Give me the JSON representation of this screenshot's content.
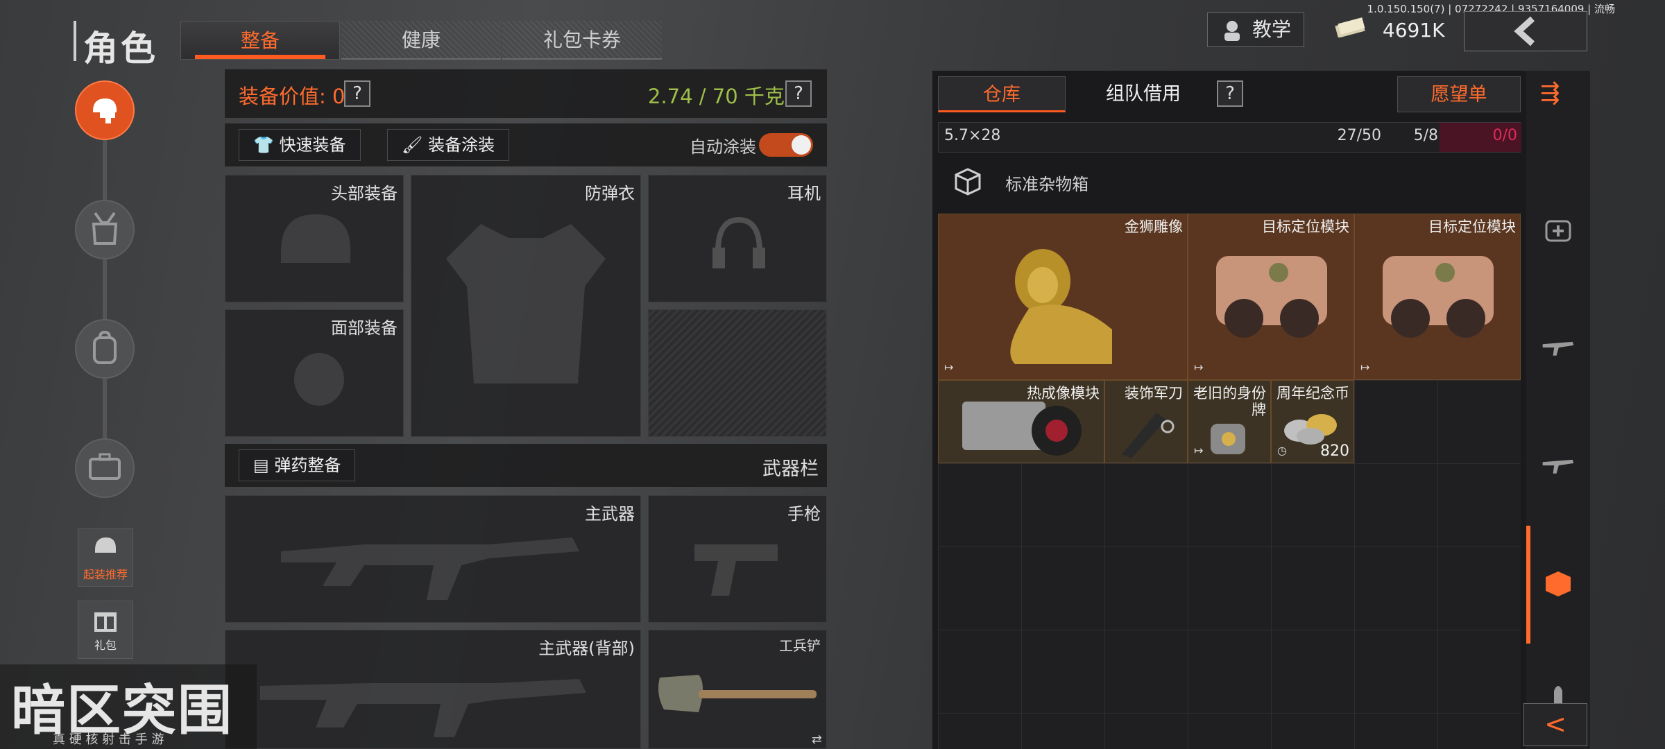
{
  "header": {
    "title": "角色",
    "tabs": [
      "整备",
      "健康",
      "礼包卡券"
    ],
    "version": "1.0.150.150(7) | 07272242 | 9357164009 | 流畅",
    "tutorial_label": "教学",
    "money": "4691K",
    "back_icon": "chevron-left"
  },
  "sidebar": {
    "items": [
      "equipment-icon",
      "tactical-rig-icon",
      "backpack-icon",
      "case-icon"
    ],
    "starter_label": "起装推荐",
    "gift_label": "礼包"
  },
  "equip": {
    "value_label": "装备价值: 0",
    "weight": "2.74 / 70 千克",
    "help": "?",
    "quick_equip": "快速装备",
    "paint": "装备涂装",
    "auto_paint": "自动涂装",
    "auto_paint_on": true,
    "slots": {
      "head": "头部装备",
      "armor": "防弹衣",
      "headset": "耳机",
      "face": "面部装备"
    },
    "ammo_btn": "弹药整备",
    "weapon_bar": "武器栏",
    "weapons": {
      "primary": "主武器",
      "pistol": "手枪",
      "primary_back": "主武器(背部)",
      "shovel": "工兵铲"
    }
  },
  "warehouse": {
    "tabs": [
      "仓库",
      "组队借用"
    ],
    "help": "?",
    "wishlist": "愿望单",
    "ammo_row": {
      "name": "5.7×28",
      "a": "27/50",
      "b": "5/8",
      "c": "0/0"
    },
    "container_label": "标准杂物箱",
    "items": [
      {
        "name": "金狮雕像"
      },
      {
        "name": "目标定位模块"
      },
      {
        "name": "目标定位模块"
      },
      {
        "name": "热成像模块"
      },
      {
        "name": "装饰军刀"
      },
      {
        "name": "老旧的身份牌"
      },
      {
        "name": "周年纪念币",
        "count": "820"
      }
    ]
  },
  "logo": {
    "title": "暗区突围",
    "subtitle": "真 硬 核 射 击 手 游"
  },
  "colors": {
    "accent": "#ff6b2d",
    "weight_green": "#9fc048",
    "item_big": "#5a3620",
    "item_small": "#3d3324"
  }
}
